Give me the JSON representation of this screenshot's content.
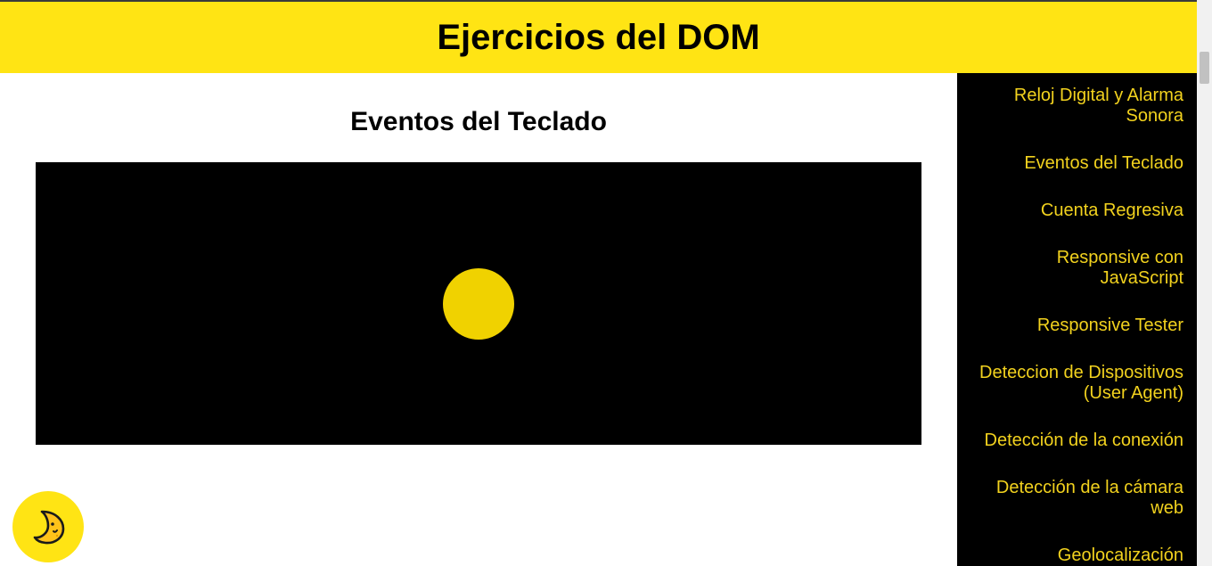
{
  "header": {
    "title": "Ejercicios del DOM"
  },
  "main": {
    "section_title": "Eventos del Teclado"
  },
  "sidebar": {
    "items": [
      {
        "label": "Reloj Digital y Alarma Sonora"
      },
      {
        "label": "Eventos del Teclado"
      },
      {
        "label": "Cuenta Regresiva"
      },
      {
        "label": "Responsive con JavaScript"
      },
      {
        "label": "Responsive Tester"
      },
      {
        "label": "Deteccion de Dispositivos (User Agent)"
      },
      {
        "label": "Detección de la conexión"
      },
      {
        "label": "Detección de la cámara web"
      },
      {
        "label": "Geolocalización"
      }
    ]
  },
  "theme_button": {
    "icon": "moon-icon"
  },
  "colors": {
    "accent": "#ffe414",
    "link": "#f2d21e",
    "ball": "#f0d200",
    "stage": "#000000"
  }
}
